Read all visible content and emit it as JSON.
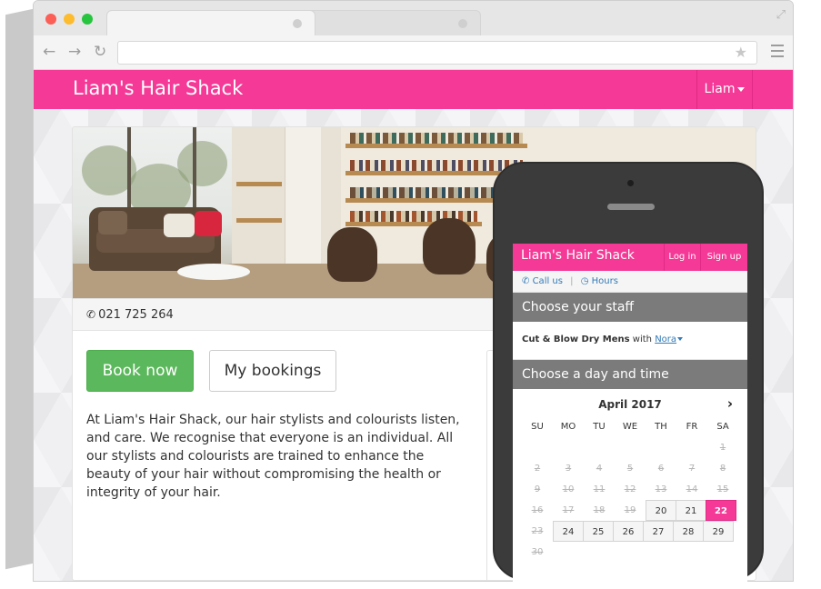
{
  "site": {
    "brand": "Liam's Hair Shack",
    "user_menu": "Liam",
    "phone": "021 725 264",
    "book_now": "Book now",
    "my_bookings": "My bookings",
    "about": "At Liam's Hair Shack, our hair stylists and colourists listen, and care. We recognise that everyone is an individual. All our stylists and colourists are trained to enhance the beauty of your hair without compromising the health or integrity of your hair."
  },
  "mobile": {
    "brand": "Liam's Hair Shack",
    "login": "Log in",
    "signup": "Sign up",
    "call_us": "Call us",
    "hours": "Hours",
    "choose_staff": "Choose your staff",
    "service": "Cut & Blow Dry Mens",
    "with": "with",
    "staff": "Nora",
    "choose_day": "Choose a day and time",
    "calendar": {
      "month": "April 2017",
      "days": [
        "SU",
        "MO",
        "TU",
        "WE",
        "TH",
        "FR",
        "SA"
      ],
      "weeks": [
        [
          {
            "d": ""
          },
          {
            "d": ""
          },
          {
            "d": ""
          },
          {
            "d": ""
          },
          {
            "d": ""
          },
          {
            "d": ""
          },
          {
            "d": "1",
            "s": "past"
          }
        ],
        [
          {
            "d": "2",
            "s": "past"
          },
          {
            "d": "3",
            "s": "past"
          },
          {
            "d": "4",
            "s": "past"
          },
          {
            "d": "5",
            "s": "past"
          },
          {
            "d": "6",
            "s": "past"
          },
          {
            "d": "7",
            "s": "past"
          },
          {
            "d": "8",
            "s": "past"
          }
        ],
        [
          {
            "d": "9",
            "s": "past"
          },
          {
            "d": "10",
            "s": "past"
          },
          {
            "d": "11",
            "s": "past"
          },
          {
            "d": "12",
            "s": "past"
          },
          {
            "d": "13",
            "s": "past"
          },
          {
            "d": "14",
            "s": "past"
          },
          {
            "d": "15",
            "s": "past"
          }
        ],
        [
          {
            "d": "16",
            "s": "past"
          },
          {
            "d": "17",
            "s": "past"
          },
          {
            "d": "18",
            "s": "past"
          },
          {
            "d": "19",
            "s": "past"
          },
          {
            "d": "20",
            "s": "avail"
          },
          {
            "d": "21",
            "s": "avail"
          },
          {
            "d": "22",
            "s": "today"
          }
        ],
        [
          {
            "d": "23",
            "s": "past"
          },
          {
            "d": "24",
            "s": "avail"
          },
          {
            "d": "25",
            "s": "avail"
          },
          {
            "d": "26",
            "s": "avail"
          },
          {
            "d": "27",
            "s": "avail"
          },
          {
            "d": "28",
            "s": "avail"
          },
          {
            "d": "29",
            "s": "avail"
          }
        ],
        [
          {
            "d": "30",
            "s": "past"
          },
          {
            "d": ""
          },
          {
            "d": ""
          },
          {
            "d": ""
          },
          {
            "d": ""
          },
          {
            "d": ""
          },
          {
            "d": ""
          }
        ]
      ]
    }
  },
  "colors": {
    "brand_pink": "#f43996",
    "book_green": "#5cb85c",
    "section_gray": "#7b7b7b"
  },
  "icons": [
    "back-icon",
    "forward-icon",
    "reload-icon",
    "star-icon",
    "menu-icon",
    "phone-icon",
    "clock-icon",
    "chevron-right-icon",
    "expand-icon"
  ]
}
